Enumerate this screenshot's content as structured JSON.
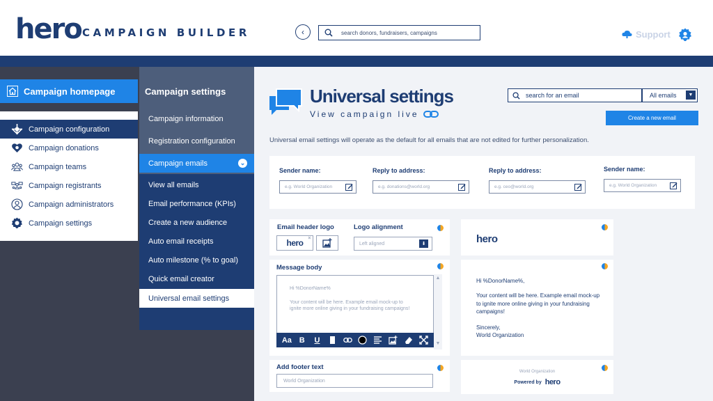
{
  "header": {
    "logo": "hero",
    "product": "CAMPAIGN BUILDER",
    "search_placeholder": "search donors, fundraisers, campaigns",
    "support": "Support"
  },
  "primary_nav": {
    "title": "Campaign homepage",
    "items": [
      {
        "label": "Campaign configuration",
        "icon": "sliders-icon",
        "active": true
      },
      {
        "label": "Campaign donations",
        "icon": "heart-icon"
      },
      {
        "label": "Campaign teams",
        "icon": "team-icon"
      },
      {
        "label": "Campaign registrants",
        "icon": "registrants-icon"
      },
      {
        "label": "Campaign administrators",
        "icon": "admin-icon"
      },
      {
        "label": "Campaign settings",
        "icon": "gear-icon"
      }
    ]
  },
  "secondary_nav": {
    "title": "Campaign settings",
    "items": [
      "Campaign information",
      "Registration configuration",
      "Campaign emails"
    ],
    "sub_items": [
      "View all emails",
      "Email performance (KPIs)",
      "Create a new audience",
      "Auto email receipts",
      "Auto milestone (% to goal)",
      "Quick email creator",
      "Universal email settings"
    ]
  },
  "main": {
    "title": "Universal settings",
    "view_live": "View campaign live",
    "email_search_placeholder": "search for an email",
    "filter_value": "All emails",
    "create_button": "Create a new email",
    "description": "Universal email settings will operate as the default for all emails that are not edited for further personalization.",
    "sender_fields": [
      {
        "label": "Sender name:",
        "placeholder": "e.g. World Organization"
      },
      {
        "label": "Reply to address:",
        "placeholder": "e.g. donations@world.org"
      },
      {
        "label": "Reply to address:",
        "placeholder": "e.g. ceo@world.org"
      },
      {
        "label": "Sender name:",
        "placeholder": "e.g. World Organization"
      }
    ],
    "header_logo": {
      "title": "Email header logo",
      "logo_text": "hero",
      "alignment_title": "Logo alignment",
      "alignment_placeholder": "Left aligned"
    },
    "message_body": {
      "title": "Message body",
      "greeting": "Hi %DonorName%",
      "content": "Your content will be here. Example email mock-up to ignite more online giving in your fundraising campaigns!",
      "toolbar": [
        "Aa",
        "B",
        "U"
      ]
    },
    "footer": {
      "title": "Add footer text",
      "placeholder": "World Organization"
    },
    "preview": {
      "logo": "hero",
      "greeting": "Hi %DonorName%,",
      "content": "Your content will be here.  Example email mock-up to ignite more online giving in your fundraising campaigns!",
      "sign_off": "Sincerely,",
      "signature": "World Organization",
      "footer_org": "World Organization",
      "powered_by": "Powered by",
      "powered_brand": "hero"
    }
  },
  "colors": {
    "navy": "#1e3d73",
    "blue": "#1f84e6",
    "slate": "#4d5e7b",
    "dark": "#3b4050",
    "bg": "#f1f3f7"
  }
}
